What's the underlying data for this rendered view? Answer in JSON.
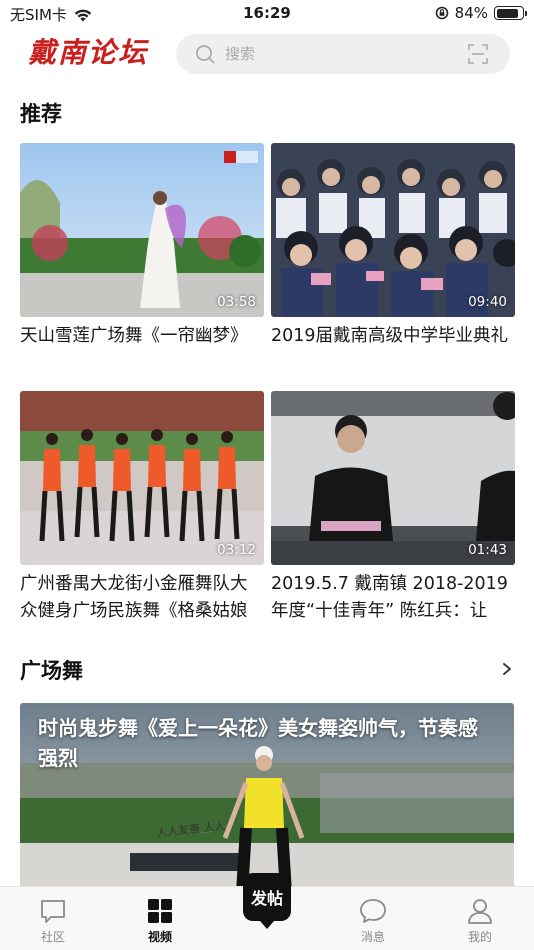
{
  "status_bar": {
    "carrier": "无SIM卡",
    "time": "16:29",
    "battery_percent": "84%",
    "battery_level": 0.84
  },
  "header": {
    "logo_text": "戴南论坛",
    "search_placeholder": "搜索"
  },
  "recommend": {
    "title": "推荐",
    "videos": [
      {
        "title": "天山雪莲广场舞《一帘幽梦》",
        "duration": "03:58"
      },
      {
        "title": "2019届戴南高级中学毕业典礼",
        "duration": "09:40"
      },
      {
        "title": "广州番禺大龙街小金雁舞队大众健身广场民族舞《格桑姑娘",
        "duration": "03:12"
      },
      {
        "title": "2019.5.7 戴南镇 2018-2019年度“十佳青年” 陈红兵：让",
        "duration": "01:43"
      }
    ]
  },
  "square_dance": {
    "title": "广场舞",
    "featured_title": "时尚鬼步舞《爱上一朵花》美女舞姿帅气，节奏感强烈",
    "sign_text": "人人友善  人人"
  },
  "tab_bar": {
    "items": [
      {
        "label": "社区",
        "icon": "chat-bubble-icon",
        "active": false
      },
      {
        "label": "视频",
        "icon": "grid-icon",
        "active": true
      },
      {
        "label": "发帖",
        "icon": "post-button",
        "active": false
      },
      {
        "label": "消息",
        "icon": "message-icon",
        "active": false
      },
      {
        "label": "我的",
        "icon": "user-icon",
        "active": false
      }
    ]
  },
  "colors": {
    "brand_red": "#c9201d",
    "text_primary": "#1a1a1a",
    "search_bg": "#efefef"
  }
}
